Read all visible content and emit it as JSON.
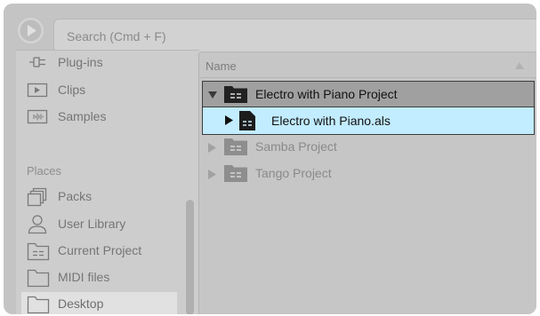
{
  "search": {
    "placeholder": "Search (Cmd + F)"
  },
  "sidebar": {
    "categories": [
      {
        "label": "Plug-ins",
        "icon": "plugin-icon"
      },
      {
        "label": "Clips",
        "icon": "clip-icon"
      },
      {
        "label": "Samples",
        "icon": "sample-icon"
      }
    ],
    "places_heading": "Places",
    "places": [
      {
        "label": "Packs",
        "icon": "packs-icon"
      },
      {
        "label": "User Library",
        "icon": "user-icon"
      },
      {
        "label": "Current Project",
        "icon": "project-folder-icon"
      },
      {
        "label": "MIDI files",
        "icon": "folder-icon"
      },
      {
        "label": "Desktop",
        "icon": "folder-icon",
        "selected": true
      }
    ]
  },
  "filelist": {
    "column_header": "Name",
    "rows": [
      {
        "label": "Electro with Piano Project",
        "type": "project-folder",
        "expanded": true
      },
      {
        "label": "Electro with Piano.als",
        "type": "live-set",
        "selected": true
      },
      {
        "label": "Samba Project",
        "type": "project-folder",
        "expanded": false
      },
      {
        "label": "Tango Project",
        "type": "project-folder",
        "expanded": false
      }
    ]
  },
  "colors": {
    "selection": "#c2ecff",
    "open_row": "#a0a0a0",
    "panel": "#c6c6c6"
  }
}
